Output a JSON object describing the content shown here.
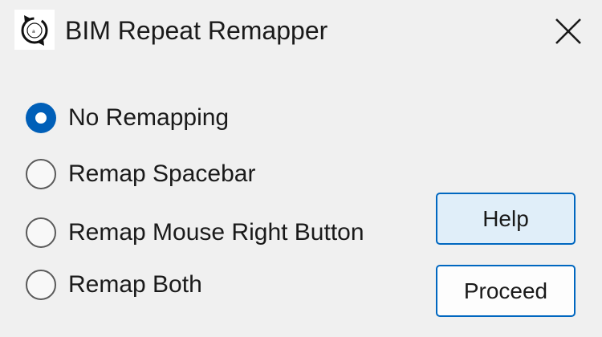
{
  "window": {
    "title": "BIM Repeat Remapper",
    "icon": "bim-repeat-logo",
    "close_icon": "close-icon"
  },
  "options": {
    "selected": "No Remapping",
    "items": [
      {
        "label": "No Remapping",
        "checked": true
      },
      {
        "label": "Remap Spacebar",
        "checked": false
      },
      {
        "label": "Remap Mouse Right Button",
        "checked": false
      },
      {
        "label": "Remap Both",
        "checked": false
      }
    ]
  },
  "buttons": {
    "help_label": "Help",
    "proceed_label": "Proceed"
  },
  "colors": {
    "accent": "#005fb8",
    "button_border": "#0067c0",
    "help_fill": "#e0eef9",
    "background": "#f0f0f0"
  }
}
